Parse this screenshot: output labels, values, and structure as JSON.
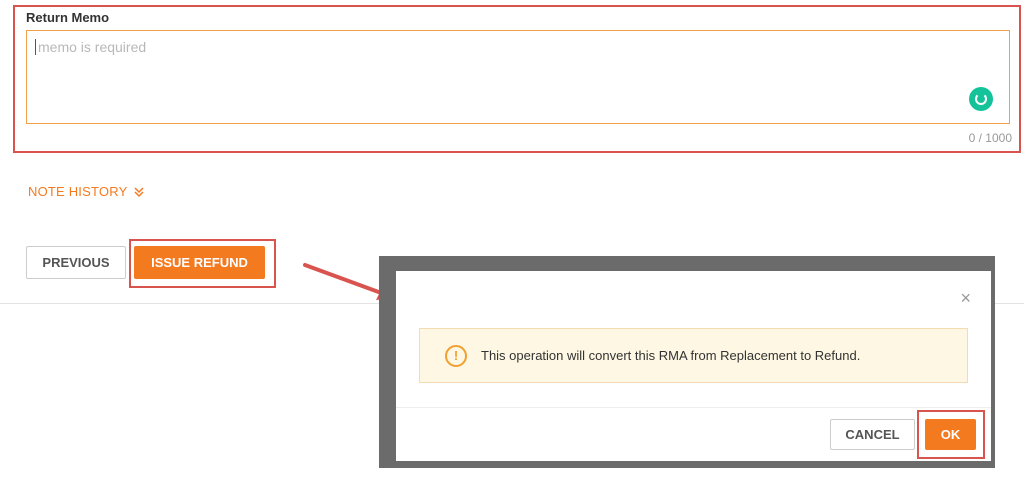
{
  "memo": {
    "label": "Return Memo",
    "placeholder": "memo is required",
    "value": "",
    "char_count": "0 / 1000"
  },
  "note_history": {
    "label": "NOTE HISTORY"
  },
  "actions": {
    "previous_label": "PREVIOUS",
    "issue_refund_label": "ISSUE REFUND"
  },
  "dialog": {
    "close_glyph": "×",
    "alert_icon_glyph": "!",
    "message": "This operation will convert this RMA from Replacement to Refund.",
    "cancel_label": "CANCEL",
    "ok_label": "OK"
  },
  "colors": {
    "accent": "#f47a20",
    "highlight": "#d9534f",
    "warning_bg": "#fdf7e3"
  },
  "icons": [
    "grammar-check-icon",
    "double-chevron-down-icon",
    "warning-icon",
    "close-icon",
    "arrow-annotation"
  ]
}
